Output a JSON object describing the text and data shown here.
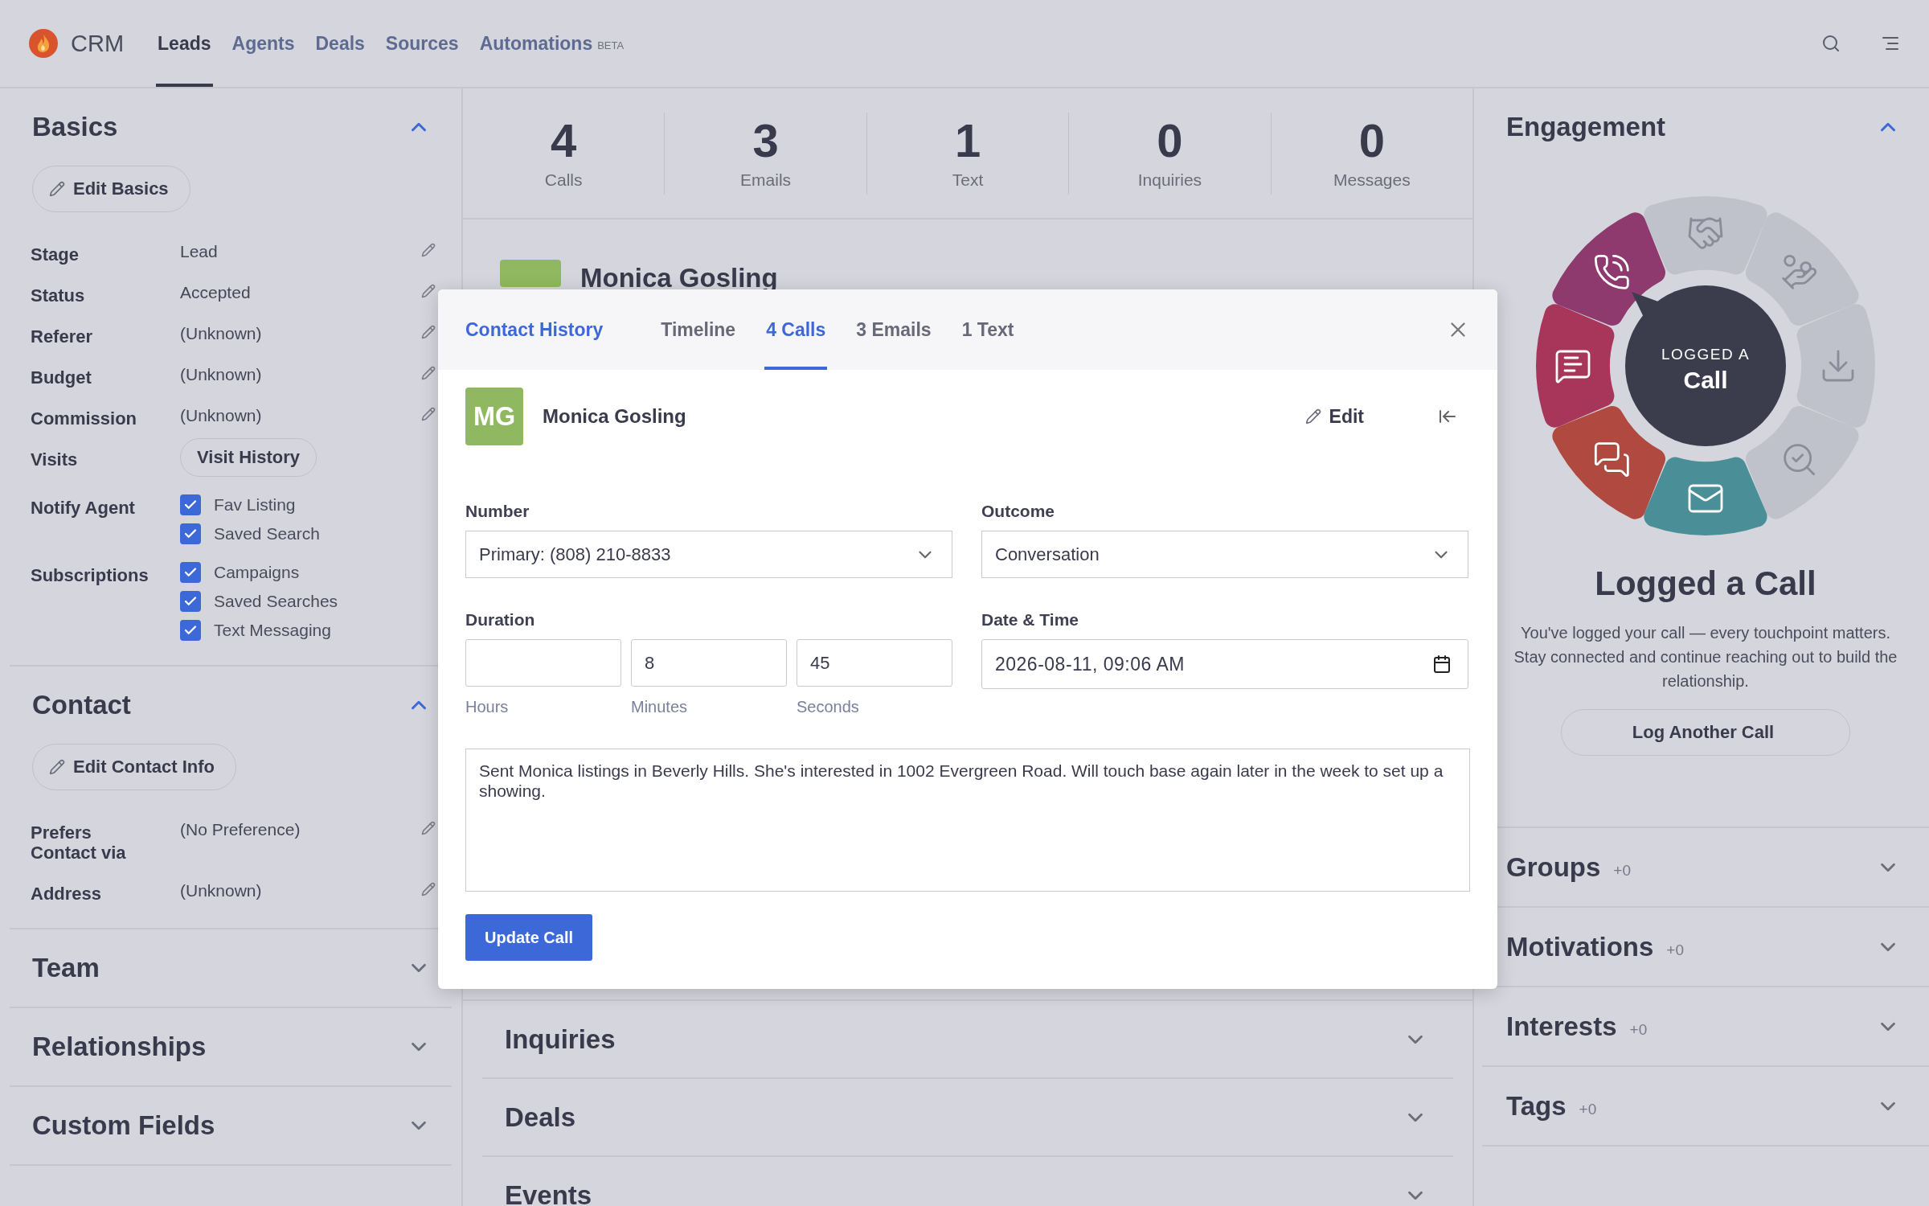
{
  "nav": {
    "brand": "CRM",
    "tabs": [
      {
        "label": "Leads",
        "selected": true
      },
      {
        "label": "Agents",
        "selected": false
      },
      {
        "label": "Deals",
        "selected": false
      },
      {
        "label": "Sources",
        "selected": false
      },
      {
        "label": "Automations",
        "selected": false,
        "badge": "BETA"
      }
    ]
  },
  "left_panel": {
    "sections": [
      {
        "title": "Basics",
        "expanded": true,
        "edit_button": "Edit Basics",
        "rows": [
          {
            "kind": "value",
            "label": "Stage",
            "value": "Lead"
          },
          {
            "kind": "value",
            "label": "Status",
            "value": "Accepted"
          },
          {
            "kind": "value",
            "label": "Referer",
            "value": "(Unknown)"
          },
          {
            "kind": "value",
            "label": "Budget",
            "value": "(Unknown)"
          },
          {
            "kind": "value",
            "label": "Commission",
            "value": "(Unknown)"
          },
          {
            "kind": "button",
            "label": "Visits",
            "button": "Visit History"
          },
          {
            "kind": "checks",
            "label": "Notify Agent",
            "options": [
              {
                "label": "Fav Listing",
                "checked": true
              },
              {
                "label": "Saved Search",
                "checked": true
              }
            ]
          },
          {
            "kind": "checks",
            "label": "Subscriptions",
            "options": [
              {
                "label": "Campaigns",
                "checked": true
              },
              {
                "label": "Saved Searches",
                "checked": true
              },
              {
                "label": "Text Messaging",
                "checked": true
              }
            ]
          }
        ]
      },
      {
        "title": "Contact",
        "expanded": true,
        "edit_button": "Edit Contact Info",
        "rows": [
          {
            "kind": "value",
            "label": "Prefers Contact via",
            "value": "(No Preference)"
          },
          {
            "kind": "value",
            "label": "Address",
            "value": "(Unknown)"
          }
        ]
      },
      {
        "title": "Team",
        "expanded": false
      },
      {
        "title": "Relationships",
        "expanded": false
      },
      {
        "title": "Custom Fields",
        "expanded": false
      }
    ]
  },
  "stats": [
    {
      "value": "4",
      "label": "Calls"
    },
    {
      "value": "3",
      "label": "Emails"
    },
    {
      "value": "1",
      "label": "Text"
    },
    {
      "value": "0",
      "label": "Inquiries"
    },
    {
      "value": "0",
      "label": "Messages"
    }
  ],
  "profile": {
    "name": "Monica Gosling"
  },
  "center_sections": [
    {
      "title": "Inquiries",
      "expanded": false
    },
    {
      "title": "Deals",
      "expanded": false
    },
    {
      "title": "Events",
      "expanded": false
    }
  ],
  "engagement": {
    "title": "Engagement",
    "expanded": true,
    "caption": "LOGGED A",
    "label": "Call",
    "segments": [
      {
        "kind": "handshake",
        "active": false
      },
      {
        "kind": "money",
        "active": false
      },
      {
        "kind": "download",
        "active": false
      },
      {
        "kind": "search",
        "active": false
      },
      {
        "kind": "mail",
        "active": true,
        "color": "#4a8f98"
      },
      {
        "kind": "chat",
        "active": true,
        "color": "#b0493f"
      },
      {
        "kind": "message",
        "active": true,
        "color": "#a8365a"
      },
      {
        "kind": "call",
        "active": true,
        "color": "#8e3a6f"
      }
    ],
    "heading": "Logged a Call",
    "description": "You've logged your call — every touchpoint matters. Stay connected and continue reaching out to build the relationship.",
    "button": "Log Another Call"
  },
  "right_sections": [
    {
      "title": "Groups",
      "count": "+0",
      "expanded": false
    },
    {
      "title": "Motivations",
      "count": "+0",
      "expanded": false
    },
    {
      "title": "Interests",
      "count": "+0",
      "expanded": false
    },
    {
      "title": "Tags",
      "count": "+0",
      "expanded": false
    }
  ],
  "modal": {
    "title": "Contact History",
    "tabs": [
      {
        "label": "Timeline",
        "selected": false
      },
      {
        "label": "4 Calls",
        "selected": true
      },
      {
        "label": "3 Emails",
        "selected": false
      },
      {
        "label": "1 Text",
        "selected": false
      }
    ],
    "contact": {
      "initials": "MG",
      "name": "Monica Gosling",
      "edit": "Edit"
    },
    "number": {
      "label": "Number",
      "value": "Primary: (808) 210-8833"
    },
    "outcome": {
      "label": "Outcome",
      "value": "Conversation"
    },
    "duration": {
      "label": "Duration",
      "fields": [
        {
          "caption": "Hours"
        },
        {
          "value": "8",
          "caption": "Minutes"
        },
        {
          "value": "45",
          "caption": "Seconds"
        }
      ]
    },
    "datetime": {
      "label": "Date & Time",
      "value": "2026-08-11, 09:06 AM"
    },
    "note": "Sent Monica listings in Beverly Hills. She's interested in 1002 Evergreen Road. Will touch base again later in the week to set up a showing.",
    "submit": "Update Call"
  }
}
